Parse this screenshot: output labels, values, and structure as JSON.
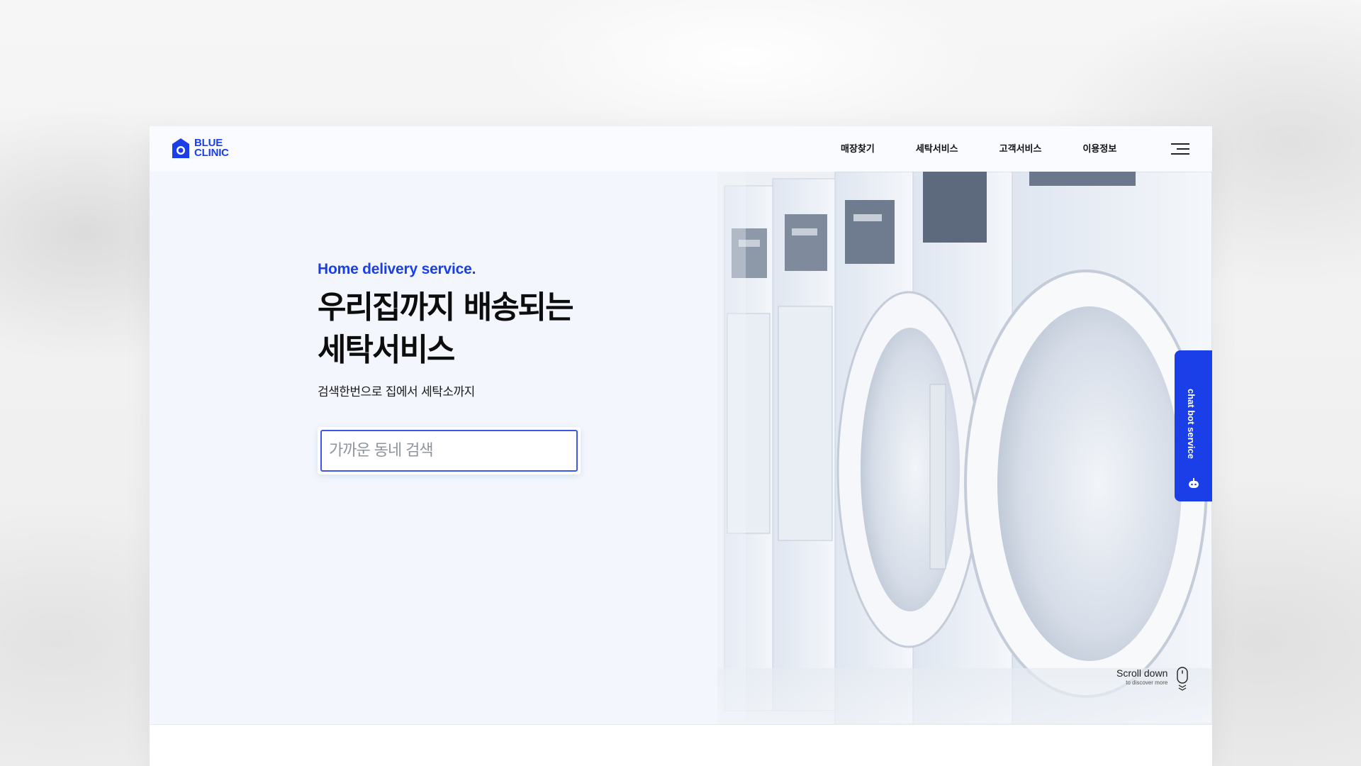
{
  "brand": {
    "line1": "BLUE",
    "line2": "CLINIC",
    "accent": "#1a3fe8"
  },
  "nav": {
    "items": [
      {
        "label": "매장찾기"
      },
      {
        "label": "세탁서비스"
      },
      {
        "label": "고객서비스"
      },
      {
        "label": "이용정보"
      }
    ],
    "menu_icon": "hamburger-menu-icon"
  },
  "hero": {
    "eyebrow": "Home delivery service.",
    "headline_line1": "우리집까지 배송되는",
    "headline_line2": "세탁서비스",
    "subline": "검색한번으로 집에서 세탁소까지"
  },
  "search": {
    "placeholder": "가까운 동네 검색",
    "value": ""
  },
  "chatbot": {
    "label": "chat bot service",
    "icon": "robot-icon",
    "color": "#1a3fe8"
  },
  "scroll": {
    "title": "Scroll down",
    "subtitle": "to discover more",
    "icon": "mouse-icon"
  },
  "colors": {
    "hero_bg": "#f3f7fd",
    "text": "#0d0d0d"
  }
}
